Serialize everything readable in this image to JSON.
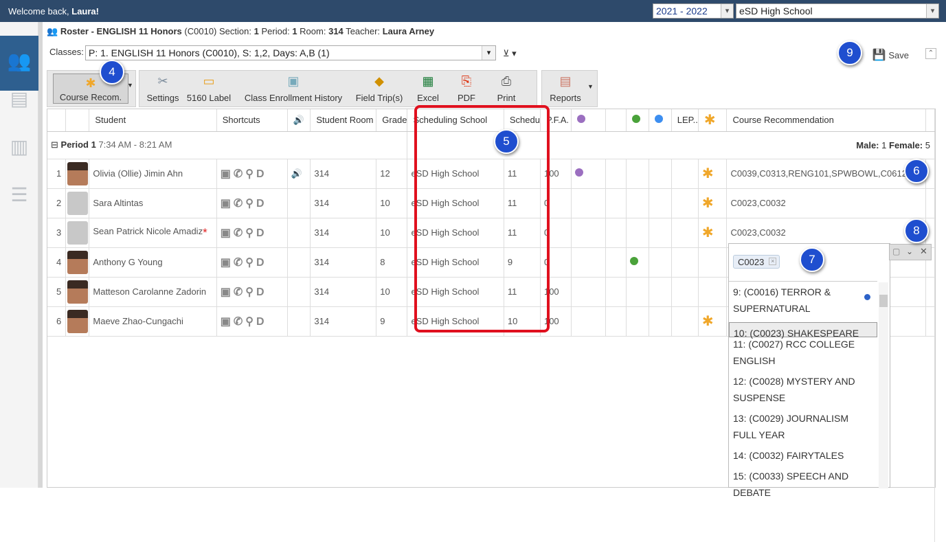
{
  "topbar": {
    "welcome_prefix": "Welcome back, ",
    "welcome_name": "Laura!",
    "year_select": "2021 - 2022",
    "school_select": "eSD High School"
  },
  "roster": {
    "label": "Roster - ENGLISH 11 Honors",
    "course_code": "(C0010)",
    "section_label": "Section:",
    "section": "1",
    "period_label": "Period:",
    "period": "1",
    "room_label": "Room:",
    "room": "314",
    "teacher_label": "Teacher:",
    "teacher": "Laura Arney"
  },
  "classes": {
    "label": "Classes:",
    "value": "P: 1. ENGLISH 11 Honors (C0010), S: 1,2, Days: A,B (1)"
  },
  "save_label": "Save",
  "toolbar": {
    "course_recom": "Course Recom.",
    "settings": "Settings",
    "label5160": "5160 Label",
    "class_enrollment_history": "Class Enrollment History",
    "field_trips": "Field Trip(s)",
    "excel": "Excel",
    "pdf": "PDF",
    "print": "Print",
    "reports": "Reports"
  },
  "columns": {
    "student": "Student",
    "shortcuts": "Shortcuts",
    "student_room": "Student Room",
    "grade": "Grade",
    "scheduling_school": "Scheduling School",
    "schedu": "Schedu",
    "pfa": "P.F.A.",
    "lep": "LEP..",
    "course_recommendation": "Course Recommendation"
  },
  "group": {
    "title": "Period 1",
    "time": "7:34 AM - 8:21 AM",
    "male_label": "Male:",
    "male": "1",
    "female_label": "Female:",
    "female": "5"
  },
  "rows": [
    {
      "num": "1",
      "name": "Olivia (Ollie) Jimin Ahn",
      "room": "314",
      "grade": "12",
      "school": "eSD High School",
      "sched": "11",
      "pfa": "100",
      "rec": "C0039,C0313,RENG101,SPWBOWL,C0612"
    },
    {
      "num": "2",
      "name": "Sara Altintas",
      "room": "314",
      "grade": "10",
      "school": "eSD High School",
      "sched": "11",
      "pfa": "0",
      "rec": "C0023,C0032"
    },
    {
      "num": "3",
      "name": "Sean Patrick Nicole Amadiz",
      "room": "314",
      "grade": "10",
      "school": "eSD High School",
      "sched": "11",
      "pfa": "0",
      "rec": "C0023,C0032"
    },
    {
      "num": "4",
      "name": "Anthony G Young",
      "room": "314",
      "grade": "8",
      "school": "eSD High School",
      "sched": "9",
      "pfa": "0",
      "rec": ""
    },
    {
      "num": "5",
      "name": "Matteson Carolanne Zadorin",
      "room": "314",
      "grade": "10",
      "school": "eSD High School",
      "sched": "11",
      "pfa": "100",
      "rec": ""
    },
    {
      "num": "6",
      "name": "Maeve Zhao-Cungachi",
      "room": "314",
      "grade": "9",
      "school": "eSD High School",
      "sched": "10",
      "pfa": "100",
      "rec": ""
    }
  ],
  "popup": {
    "chip": "C0023",
    "options": [
      "9: (C0016) TERROR & SUPERNATURAL",
      "10: (C0023) SHAKESPEARE",
      "11: (C0027) RCC COLLEGE ENGLISH",
      "12: (C0028) MYSTERY AND SUSPENSE",
      "13: (C0029) JOURNALISM FULL YEAR",
      "14: (C0032) FAIRYTALES",
      "15: (C0033) SPEECH AND DEBATE"
    ]
  },
  "badges": {
    "b4": "4",
    "b5": "5",
    "b6": "6",
    "b7": "7",
    "b8": "8",
    "b9": "9"
  },
  "colors": {
    "highlight": "#e0101e",
    "badge": "#1f4ecf",
    "purple": "#9b6fc0",
    "green": "#4aa23a",
    "blue": "#3d8ef0",
    "star": "#f0a72a"
  }
}
